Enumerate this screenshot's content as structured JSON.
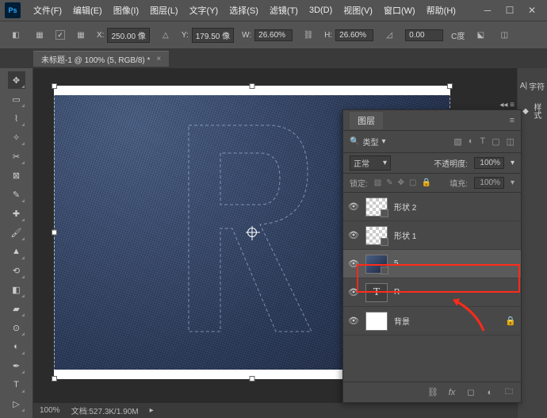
{
  "menu": {
    "items": [
      "文件(F)",
      "编辑(E)",
      "图像(I)",
      "图层(L)",
      "文字(Y)",
      "选择(S)",
      "滤镜(T)",
      "3D(D)",
      "视图(V)",
      "窗口(W)",
      "帮助(H)"
    ]
  },
  "options": {
    "x": "250.00 像",
    "y": "179.50 像",
    "w": "26.60%",
    "h": "26.60%",
    "angle": "0.00",
    "interp": "",
    "c_lbl": "C度"
  },
  "tab": {
    "title": "未标题-1 @ 100% (5, RGB/8) *"
  },
  "status": {
    "zoom": "100%",
    "doc": "文档:527.3K/1.90M"
  },
  "dock": {
    "char": "字符",
    "style": "样式"
  },
  "layers": {
    "title": "图层",
    "search_label": "类型",
    "blend": "正常",
    "opacity_lbl": "不透明度:",
    "opacity": "100%",
    "fill_lbl": "填充:",
    "fill": "100%",
    "lock_lbl": "锁定:",
    "items": [
      {
        "name": "形状 2",
        "kind": "shape"
      },
      {
        "name": "形状 1",
        "kind": "shape"
      },
      {
        "name": "5",
        "kind": "smart"
      },
      {
        "name": "R",
        "kind": "type"
      },
      {
        "name": "背景",
        "kind": "bg"
      }
    ]
  }
}
